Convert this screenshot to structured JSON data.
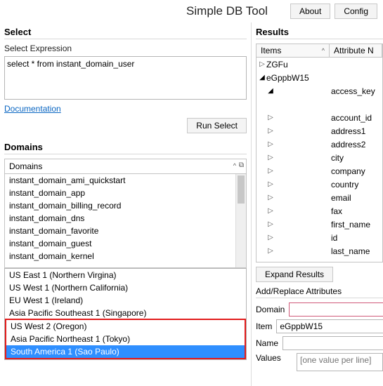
{
  "titlebar": {
    "title": "Simple DB Tool",
    "about": "About",
    "config": "Config"
  },
  "select_panel": {
    "heading": "Select",
    "label": "Select Expression",
    "sql": "select * from instant_domain_user",
    "doc_link": "Documentation",
    "run": "Run Select"
  },
  "domains_panel": {
    "heading": "Domains",
    "combo_label": "Domains",
    "items": [
      "instant_domain_ami_quickstart",
      "instant_domain_app",
      "instant_domain_billing_record",
      "instant_domain_dns",
      "instant_domain_favorite",
      "instant_domain_guest",
      "instant_domain_kernel"
    ],
    "regions_top": [
      "US East 1 (Northern Virgina)",
      "US West 1 (Northern California)",
      "EU West 1 (Ireland)",
      "Asia Pacific Southeast 1 (Singapore)"
    ],
    "regions_highlight": [
      "US West 2 (Oregon)",
      "Asia Pacific Northeast 1 (Tokyo)",
      "South America 1 (Sao Paulo)"
    ]
  },
  "results_panel": {
    "heading": "Results",
    "col_items": "Items",
    "col_attr": "Attribute N",
    "root1": "ZGFu",
    "root2": "eGppbW15",
    "attrs": [
      "access_key",
      "account_id",
      "address1",
      "address2",
      "city",
      "company",
      "country",
      "email",
      "fax",
      "first_name",
      "id",
      "last_name"
    ],
    "expand": "Expand Results"
  },
  "addrepl": {
    "heading": "Add/Replace Attributes",
    "domain_lbl": "Domain",
    "item_lbl": "Item",
    "item_val": "eGppbW15",
    "name_lbl": "Name",
    "values_lbl": "Values",
    "values_ph": "[one value per line]"
  }
}
